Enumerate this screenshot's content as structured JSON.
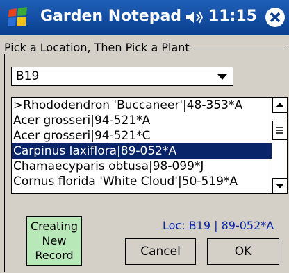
{
  "titlebar": {
    "title": "Garden Notepad",
    "time": "11:15"
  },
  "form": {
    "group_label": "Pick a Location, Then Pick a Plant",
    "location_value": "B19",
    "plants": [
      ">Rhododendron 'Buccaneer'|48-353*A",
      "Acer grosseri|94-521*A",
      "Acer grosseri|94-521*C",
      "Carpinus laxiflora|89-052*A",
      "Chamaecyparis obtusa|98-099*J",
      "Cornus florida 'White Cloud'|50-519*A"
    ],
    "selected_index": 3
  },
  "status": {
    "line1": "Creating",
    "line2": "New",
    "line3": "Record",
    "loc_text": "Loc: B19 | 89-052*A"
  },
  "buttons": {
    "cancel": "Cancel",
    "ok": "OK"
  },
  "colors": {
    "selection": "#0a246a",
    "status_bg": "#b8e8b8",
    "loc_text": "#0a24a8"
  }
}
